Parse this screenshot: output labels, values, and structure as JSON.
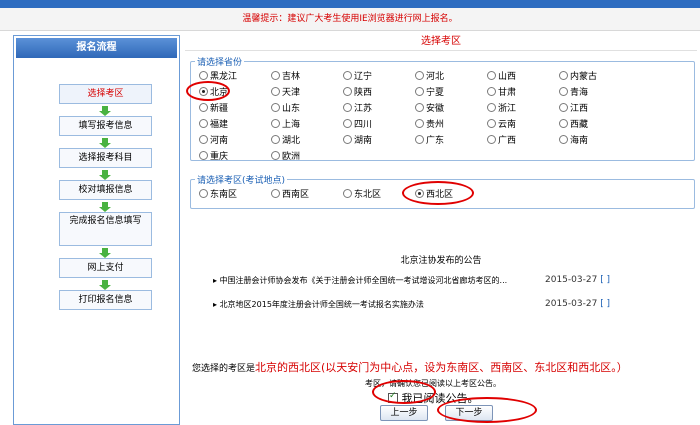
{
  "notice": "温馨提示：建议广大考生使用IE浏览器进行网上报名。",
  "sidebar": {
    "title": "报名流程",
    "steps": [
      "选择考区",
      "填写报考信息",
      "选择报考科目",
      "校对填报信息",
      "完成报名信息填写",
      "网上支付",
      "打印报名信息"
    ]
  },
  "main": {
    "title": "选择考区",
    "province_legend": "请选择省份",
    "provinces": [
      "黑龙江",
      "吉林",
      "辽宁",
      "河北",
      "山西",
      "内蒙古",
      "北京",
      "天津",
      "陕西",
      "宁夏",
      "甘肃",
      "青海",
      "新疆",
      "山东",
      "江苏",
      "安徽",
      "浙江",
      "江西",
      "福建",
      "上海",
      "四川",
      "贵州",
      "云南",
      "西藏",
      "河南",
      "湖北",
      "湖南",
      "广东",
      "广西",
      "海南",
      "重庆",
      "欧洲"
    ],
    "selected_province": "北京",
    "area_legend": "请选择考区(考试地点)",
    "areas": [
      "东南区",
      "西南区",
      "东北区",
      "西北区"
    ],
    "selected_area": "西北区",
    "announce_title": "北京注协发布的公告",
    "announcements": [
      {
        "bullet": "▸",
        "text": "中国注册会计师协会发布《关于注册会计师全国统一考试增设河北省廊坊考区的...",
        "date": "2015-03-27",
        "action": "[ ]"
      },
      {
        "bullet": "▸",
        "text": "北京地区2015年度注册会计师全国统一考试报名实施办法",
        "date": "2015-03-27",
        "action": "[ ]"
      }
    ],
    "chosen_prefix": "您选择的考区是",
    "chosen_text": "北京的西北区(以天安门为中心点，设为东南区、西南区、东北区和西北区。）",
    "chosen_note": "考区，请确认您已阅读以上考区公告。",
    "agree_label": "我已阅读公告。",
    "prev_button": "上一步",
    "next_button": "下一步"
  },
  "colors": {
    "accent": "#2d6cc0",
    "alert": "#d60000",
    "highlight": "#e00000"
  }
}
